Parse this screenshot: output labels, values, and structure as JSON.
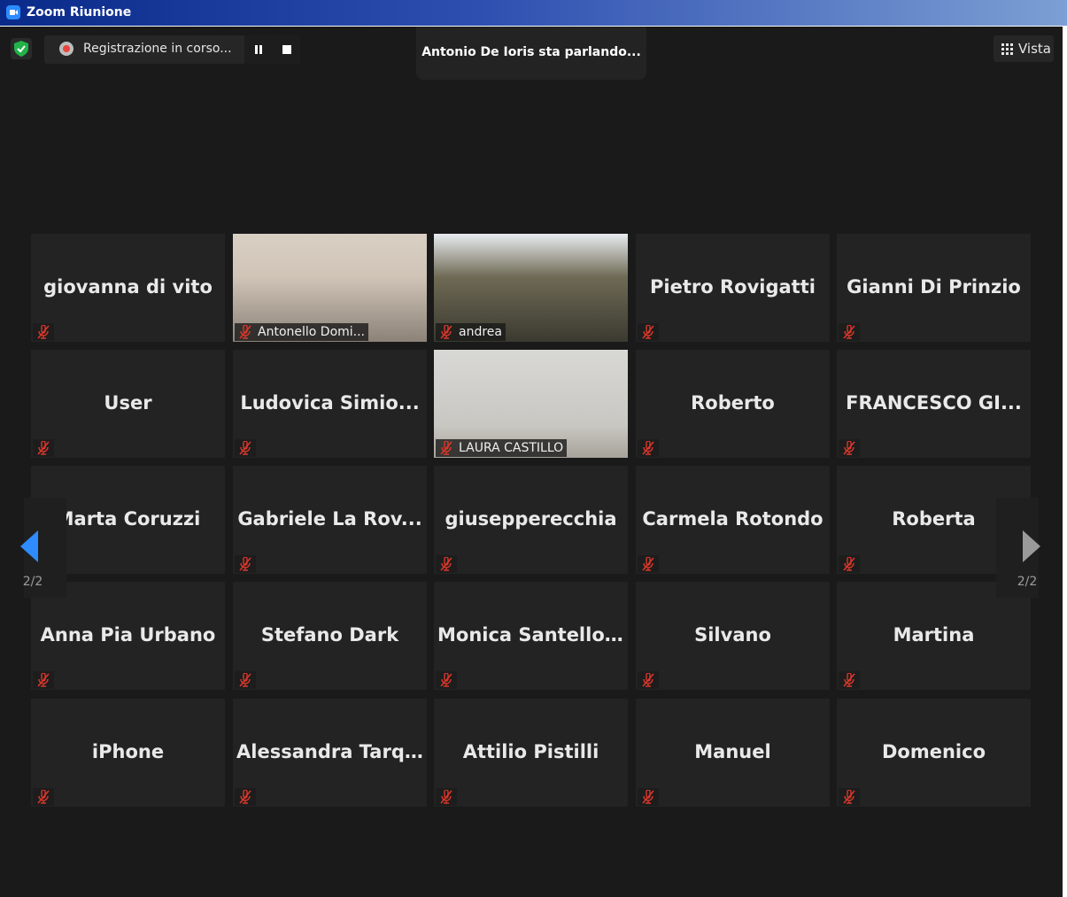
{
  "window": {
    "title": "Zoom Riunione"
  },
  "toolbar": {
    "recording_text": "Registrazione in corso...",
    "speaking_text": "Antonio De Ioris sta parlando...",
    "view_label": "Vista"
  },
  "pager": {
    "left_page": "2/2",
    "right_page": "2/2"
  },
  "colors": {
    "accent": "#2d8cff",
    "mute_red": "#d9372a",
    "shield_green": "#21b34a"
  },
  "participants": [
    {
      "name": "giovanna di vito",
      "video": false
    },
    {
      "name": "Antonello Domi...",
      "video": true
    },
    {
      "name": "andrea",
      "video": true
    },
    {
      "name": "Pietro Rovigatti",
      "video": false
    },
    {
      "name": "Gianni Di Prinzio",
      "video": false
    },
    {
      "name": "User",
      "video": false
    },
    {
      "name": "Ludovica  Simio...",
      "video": false
    },
    {
      "name": "LAURA CASTILLO",
      "video": true
    },
    {
      "name": "Roberto",
      "video": false
    },
    {
      "name": "FRANCESCO  GI...",
      "video": false
    },
    {
      "name": "Marta Coruzzi",
      "video": false
    },
    {
      "name": "Gabriele  La  Rov...",
      "video": false
    },
    {
      "name": "giusepperecchia",
      "video": false
    },
    {
      "name": "Carmela Rotondo",
      "video": false
    },
    {
      "name": "Roberta",
      "video": false
    },
    {
      "name": "Anna Pia Urbano",
      "video": false
    },
    {
      "name": "Stefano Dark",
      "video": false
    },
    {
      "name": "Monica  Santello...",
      "video": false
    },
    {
      "name": "Silvano",
      "video": false
    },
    {
      "name": "Martina",
      "video": false
    },
    {
      "name": "iPhone",
      "video": false
    },
    {
      "name": "Alessandra  Tarq...",
      "video": false
    },
    {
      "name": "Attilio Pistilli",
      "video": false
    },
    {
      "name": "Manuel",
      "video": false
    },
    {
      "name": "Domenico",
      "video": false
    }
  ]
}
